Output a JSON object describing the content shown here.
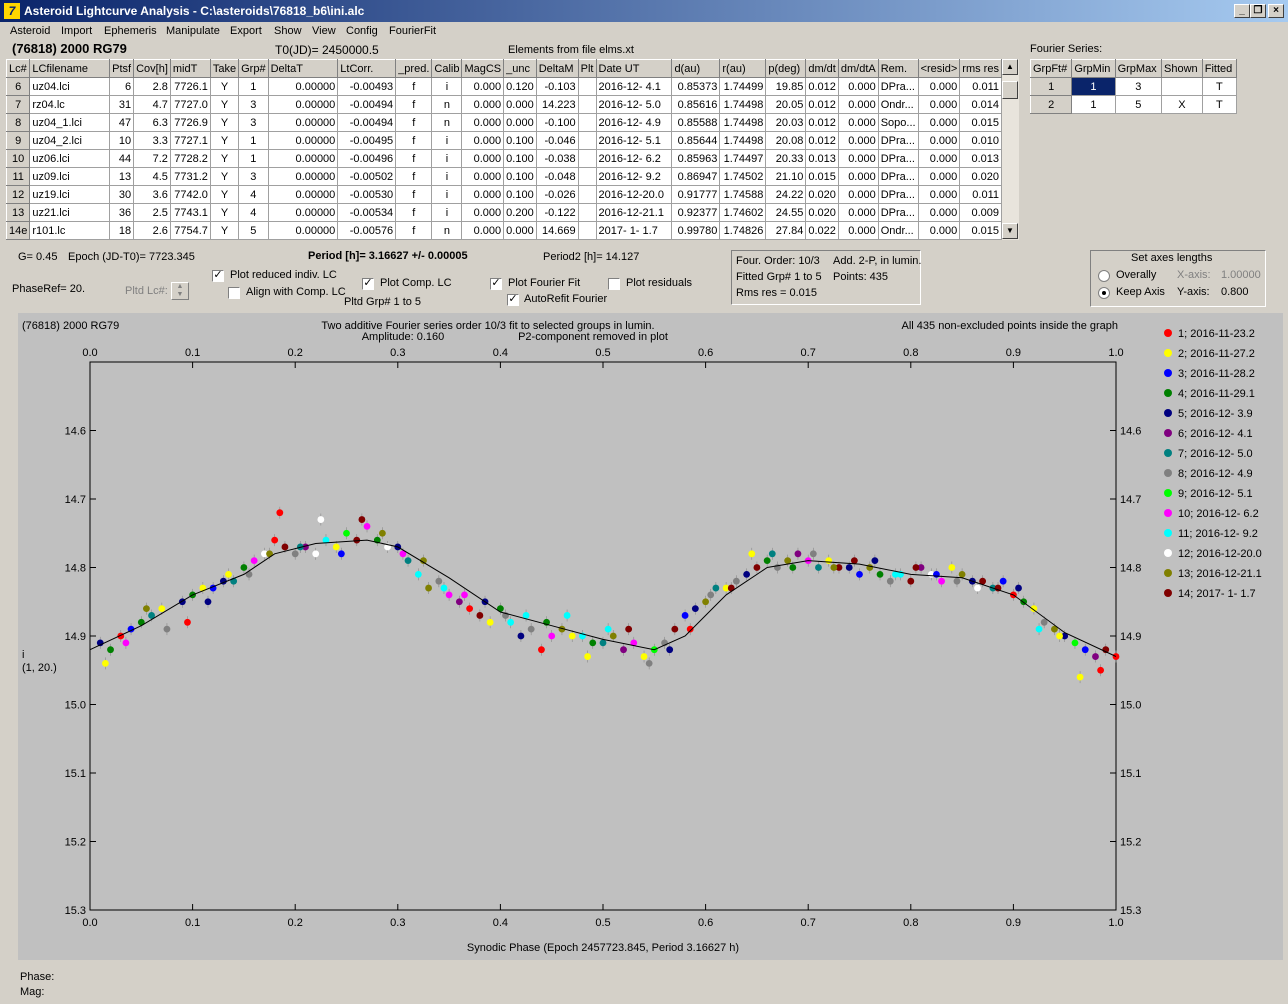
{
  "window": {
    "title": "Asteroid Lightcurve Analysis - C:\\asteroids\\76818_b6\\ini.alc",
    "icon": "7"
  },
  "menu": [
    "Asteroid",
    "Import",
    "Ephemeris",
    "Manipulate",
    "Export",
    "Show",
    "View",
    "Config",
    "FourierFit"
  ],
  "header": {
    "object": "(76818) 2000 RG79",
    "t0": "T0(JD)= 2450000.5",
    "elements": "Elements from file elms.xt"
  },
  "table": {
    "columns": [
      "Lc#",
      "LCfilename",
      "Ptsf",
      "Cov[h]",
      "midT",
      "Take",
      "Grp#",
      "DeltaT",
      "LtCorr.",
      "_pred.",
      "Calib",
      "MagCS",
      "_unc",
      "DeltaM",
      "Plt",
      "Date UT",
      "d(au)",
      "r(au)",
      "p(deg)",
      "dm/dt",
      "dm/dtA",
      "Rem.",
      "<resid>",
      "rms res"
    ],
    "rows": [
      [
        "6",
        "uz04.lci",
        "6",
        "2.8",
        "7726.1",
        "Y",
        "1",
        "0.00000",
        "-0.00493",
        "f",
        "i",
        "0.000",
        "0.120",
        "-0.103",
        "",
        "2016-12- 4.1",
        "0.85373",
        "1.74499",
        "19.85",
        "0.012",
        "0.000",
        "DPra...",
        "0.000",
        "0.011"
      ],
      [
        "7",
        "rz04.lc",
        "31",
        "4.7",
        "7727.0",
        "Y",
        "3",
        "0.00000",
        "-0.00494",
        "f",
        "n",
        "0.000",
        "0.000",
        "14.223",
        "",
        "2016-12- 5.0",
        "0.85616",
        "1.74498",
        "20.05",
        "0.012",
        "0.000",
        "Ondr...",
        "0.000",
        "0.014"
      ],
      [
        "8",
        "uz04_1.lci",
        "47",
        "6.3",
        "7726.9",
        "Y",
        "3",
        "0.00000",
        "-0.00494",
        "f",
        "n",
        "0.000",
        "0.000",
        "-0.100",
        "",
        "2016-12- 4.9",
        "0.85588",
        "1.74498",
        "20.03",
        "0.012",
        "0.000",
        "Sopo...",
        "0.000",
        "0.015"
      ],
      [
        "9",
        "uz04_2.lci",
        "10",
        "3.3",
        "7727.1",
        "Y",
        "1",
        "0.00000",
        "-0.00495",
        "f",
        "i",
        "0.000",
        "0.100",
        "-0.046",
        "",
        "2016-12- 5.1",
        "0.85644",
        "1.74498",
        "20.08",
        "0.012",
        "0.000",
        "DPra...",
        "0.000",
        "0.010"
      ],
      [
        "10",
        "uz06.lci",
        "44",
        "7.2",
        "7728.2",
        "Y",
        "1",
        "0.00000",
        "-0.00496",
        "f",
        "i",
        "0.000",
        "0.100",
        "-0.038",
        "",
        "2016-12- 6.2",
        "0.85963",
        "1.74497",
        "20.33",
        "0.013",
        "0.000",
        "DPra...",
        "0.000",
        "0.013"
      ],
      [
        "11",
        "uz09.lci",
        "13",
        "4.5",
        "7731.2",
        "Y",
        "3",
        "0.00000",
        "-0.00502",
        "f",
        "i",
        "0.000",
        "0.100",
        "-0.048",
        "",
        "2016-12- 9.2",
        "0.86947",
        "1.74502",
        "21.10",
        "0.015",
        "0.000",
        "DPra...",
        "0.000",
        "0.020"
      ],
      [
        "12",
        "uz19.lci",
        "30",
        "3.6",
        "7742.0",
        "Y",
        "4",
        "0.00000",
        "-0.00530",
        "f",
        "i",
        "0.000",
        "0.100",
        "-0.026",
        "",
        "2016-12-20.0",
        "0.91777",
        "1.74588",
        "24.22",
        "0.020",
        "0.000",
        "DPra...",
        "0.000",
        "0.011"
      ],
      [
        "13",
        "uz21.lci",
        "36",
        "2.5",
        "7743.1",
        "Y",
        "4",
        "0.00000",
        "-0.00534",
        "f",
        "i",
        "0.000",
        "0.200",
        "-0.122",
        "",
        "2016-12-21.1",
        "0.92377",
        "1.74602",
        "24.55",
        "0.020",
        "0.000",
        "DPra...",
        "0.000",
        "0.009"
      ],
      [
        "14e",
        "r101.lc",
        "18",
        "2.6",
        "7754.7",
        "Y",
        "5",
        "0.00000",
        "-0.00576",
        "f",
        "n",
        "0.000",
        "0.000",
        "14.669",
        "",
        "2017- 1- 1.7",
        "0.99780",
        "1.74826",
        "27.84",
        "0.022",
        "0.000",
        "Ondr...",
        "0.000",
        "0.015"
      ]
    ]
  },
  "fourier_series": {
    "title": "Fourier Series:",
    "columns": [
      "GrpFt#",
      "GrpMin",
      "GrpMax",
      "Shown",
      "Fitted"
    ],
    "rows": [
      [
        "1",
        "1",
        "3",
        "",
        "T"
      ],
      [
        "2",
        "1",
        "5",
        "X",
        "T"
      ]
    ]
  },
  "controls": {
    "g": "G= 0.45",
    "epoch": "Epoch (JD-T0)= 7723.345",
    "period": "Period [h]= 3.16627 +/- 0.00005",
    "period2": "Period2 [h]= 14.127",
    "phaseref": "PhaseRef= 20.",
    "pltd_lc": "Pltd Lc#:",
    "plot_reduced": "Plot reduced indiv. LC",
    "align_comp": "Align with Comp. LC",
    "plot_comp": "Plot Comp. LC",
    "pltd_grp": "Pltd Grp#  1   to   5",
    "plot_fourier": "Plot Fourier Fit",
    "autorefit": "AutoRefit Fourier",
    "plot_residuals": "Plot residuals",
    "info1": "Four. Order: 10/3",
    "info2": "Add. 2-P, in lumin.",
    "info3": "Fitted Grp# 1 to 5",
    "info4": "Points: 435",
    "info5": "Rms res      = 0.015",
    "axes_title": "Set axes lengths",
    "overally": "Overally",
    "keep_axis": "Keep Axis",
    "xaxis_label": "X-axis:",
    "xaxis_val": "1.00000",
    "yaxis_label": "Y-axis:",
    "yaxis_val": "0.800"
  },
  "plot": {
    "object": "(76818) 2000 RG79",
    "subtitle1": "Two additive Fourier series order 10/3 fit to selected groups in lumin.",
    "subtitle2": "Amplitude: 0.160",
    "subtitle3": "P2-component removed in plot",
    "note": "All 435 non-excluded points inside the graph",
    "xlabel": "Synodic Phase (Epoch 2457723.845, Period 3.16627 h)",
    "ylabel": "i",
    "ylabel2": "(1, 20.)"
  },
  "status": {
    "phase": "Phase:",
    "mag": "Mag:"
  },
  "chart_data": {
    "type": "scatter",
    "xlim": [
      0,
      1
    ],
    "ylim": [
      15.3,
      14.5
    ],
    "xticks": [
      "0.0",
      "0.1",
      "0.2",
      "0.3",
      "0.4",
      "0.5",
      "0.6",
      "0.7",
      "0.8",
      "0.9",
      "1.0"
    ],
    "yticks": [
      "14.6",
      "14.7",
      "14.8",
      "14.9",
      "15.0",
      "15.1",
      "15.2",
      "15.3"
    ],
    "legend_placement": "right",
    "legend": [
      {
        "name": "1; 2016-11-23.2",
        "color": "#ff0000"
      },
      {
        "name": "2; 2016-11-27.2",
        "color": "#ffff00"
      },
      {
        "name": "3; 2016-11-28.2",
        "color": "#0000ff"
      },
      {
        "name": "4; 2016-11-29.1",
        "color": "#008000"
      },
      {
        "name": "5; 2016-12- 3.9",
        "color": "#000080"
      },
      {
        "name": "6; 2016-12- 4.1",
        "color": "#800080"
      },
      {
        "name": "7; 2016-12- 5.0",
        "color": "#008080"
      },
      {
        "name": "8; 2016-12- 4.9",
        "color": "#808080"
      },
      {
        "name": "9; 2016-12- 5.1",
        "color": "#00ff00"
      },
      {
        "name": "10; 2016-12- 6.2",
        "color": "#ff00ff"
      },
      {
        "name": "11; 2016-12- 9.2",
        "color": "#00ffff"
      },
      {
        "name": "12; 2016-12-20.0",
        "color": "#ffffff"
      },
      {
        "name": "13; 2016-12-21.1",
        "color": "#808000"
      },
      {
        "name": "14; 2017- 1- 1.7",
        "color": "#800000"
      }
    ],
    "fit_curve": {
      "x": [
        0,
        0.05,
        0.1,
        0.15,
        0.18,
        0.22,
        0.27,
        0.3,
        0.35,
        0.4,
        0.45,
        0.5,
        0.55,
        0.58,
        0.62,
        0.66,
        0.7,
        0.75,
        0.8,
        0.85,
        0.9,
        0.95,
        1.0
      ],
      "y": [
        14.92,
        14.885,
        14.84,
        14.81,
        14.78,
        14.765,
        14.76,
        14.77,
        14.815,
        14.865,
        14.885,
        14.905,
        14.92,
        14.9,
        14.84,
        14.8,
        14.79,
        14.795,
        14.81,
        14.815,
        14.84,
        14.895,
        14.93
      ]
    },
    "points": [
      [
        0.01,
        14.91,
        4
      ],
      [
        0.02,
        14.92,
        3
      ],
      [
        0.03,
        14.9,
        0
      ],
      [
        0.04,
        14.89,
        2
      ],
      [
        0.05,
        14.88,
        3
      ],
      [
        0.06,
        14.87,
        6
      ],
      [
        0.07,
        14.86,
        1
      ],
      [
        0.09,
        14.85,
        4
      ],
      [
        0.1,
        14.84,
        3
      ],
      [
        0.11,
        14.83,
        1
      ],
      [
        0.12,
        14.83,
        2
      ],
      [
        0.13,
        14.82,
        4
      ],
      [
        0.14,
        14.82,
        6
      ],
      [
        0.15,
        14.8,
        3
      ],
      [
        0.16,
        14.79,
        9
      ],
      [
        0.17,
        14.78,
        11
      ],
      [
        0.18,
        14.76,
        0
      ],
      [
        0.19,
        14.77,
        13
      ],
      [
        0.2,
        14.78,
        7
      ],
      [
        0.21,
        14.77,
        5
      ],
      [
        0.22,
        14.78,
        11
      ],
      [
        0.23,
        14.76,
        10
      ],
      [
        0.24,
        14.77,
        1
      ],
      [
        0.25,
        14.75,
        8
      ],
      [
        0.26,
        14.76,
        13
      ],
      [
        0.27,
        14.74,
        9
      ],
      [
        0.28,
        14.76,
        3
      ],
      [
        0.29,
        14.77,
        11
      ],
      [
        0.3,
        14.77,
        4
      ],
      [
        0.31,
        14.79,
        6
      ],
      [
        0.32,
        14.81,
        10
      ],
      [
        0.33,
        14.83,
        12
      ],
      [
        0.34,
        14.82,
        7
      ],
      [
        0.35,
        14.84,
        9
      ],
      [
        0.36,
        14.85,
        5
      ],
      [
        0.37,
        14.86,
        0
      ],
      [
        0.38,
        14.87,
        13
      ],
      [
        0.39,
        14.88,
        1
      ],
      [
        0.4,
        14.86,
        3
      ],
      [
        0.41,
        14.88,
        10
      ],
      [
        0.42,
        14.9,
        4
      ],
      [
        0.43,
        14.89,
        7
      ],
      [
        0.44,
        14.92,
        0
      ],
      [
        0.45,
        14.9,
        9
      ],
      [
        0.46,
        14.89,
        12
      ],
      [
        0.47,
        14.9,
        1
      ],
      [
        0.48,
        14.9,
        10
      ],
      [
        0.49,
        14.91,
        3
      ],
      [
        0.5,
        14.91,
        6
      ],
      [
        0.51,
        14.9,
        12
      ],
      [
        0.52,
        14.92,
        5
      ],
      [
        0.53,
        14.91,
        9
      ],
      [
        0.54,
        14.93,
        1
      ],
      [
        0.55,
        14.92,
        8
      ],
      [
        0.56,
        14.91,
        7
      ],
      [
        0.57,
        14.89,
        13
      ],
      [
        0.58,
        14.87,
        2
      ],
      [
        0.59,
        14.86,
        4
      ],
      [
        0.6,
        14.85,
        12
      ],
      [
        0.61,
        14.83,
        6
      ],
      [
        0.62,
        14.83,
        1
      ],
      [
        0.63,
        14.82,
        7
      ],
      [
        0.64,
        14.81,
        4
      ],
      [
        0.65,
        14.8,
        13
      ],
      [
        0.66,
        14.79,
        3
      ],
      [
        0.67,
        14.8,
        7
      ],
      [
        0.68,
        14.79,
        12
      ],
      [
        0.69,
        14.78,
        5
      ],
      [
        0.7,
        14.79,
        9
      ],
      [
        0.71,
        14.8,
        6
      ],
      [
        0.72,
        14.79,
        1
      ],
      [
        0.73,
        14.8,
        13
      ],
      [
        0.74,
        14.8,
        4
      ],
      [
        0.75,
        14.81,
        2
      ],
      [
        0.76,
        14.8,
        12
      ],
      [
        0.77,
        14.81,
        3
      ],
      [
        0.78,
        14.82,
        7
      ],
      [
        0.79,
        14.81,
        10
      ],
      [
        0.8,
        14.82,
        13
      ],
      [
        0.81,
        14.8,
        5
      ],
      [
        0.82,
        14.81,
        11
      ],
      [
        0.83,
        14.82,
        9
      ],
      [
        0.84,
        14.8,
        1
      ],
      [
        0.85,
        14.81,
        12
      ],
      [
        0.86,
        14.82,
        4
      ],
      [
        0.87,
        14.82,
        13
      ],
      [
        0.88,
        14.83,
        6
      ],
      [
        0.89,
        14.82,
        2
      ],
      [
        0.9,
        14.84,
        0
      ],
      [
        0.91,
        14.85,
        3
      ],
      [
        0.92,
        14.86,
        1
      ],
      [
        0.93,
        14.88,
        7
      ],
      [
        0.94,
        14.89,
        12
      ],
      [
        0.95,
        14.9,
        4
      ],
      [
        0.96,
        14.91,
        8
      ],
      [
        0.97,
        14.92,
        2
      ],
      [
        0.98,
        14.93,
        5
      ],
      [
        0.99,
        14.92,
        13
      ],
      [
        1.0,
        14.93,
        0
      ],
      [
        0.015,
        14.94,
        1
      ],
      [
        0.035,
        14.91,
        9
      ],
      [
        0.055,
        14.86,
        12
      ],
      [
        0.075,
        14.89,
        7
      ],
      [
        0.095,
        14.88,
        0
      ],
      [
        0.115,
        14.85,
        4
      ],
      [
        0.135,
        14.81,
        1
      ],
      [
        0.155,
        14.81,
        7
      ],
      [
        0.175,
        14.78,
        12
      ],
      [
        0.185,
        14.72,
        0
      ],
      [
        0.205,
        14.77,
        6
      ],
      [
        0.225,
        14.73,
        11
      ],
      [
        0.245,
        14.78,
        2
      ],
      [
        0.265,
        14.73,
        13
      ],
      [
        0.285,
        14.75,
        12
      ],
      [
        0.305,
        14.78,
        9
      ],
      [
        0.325,
        14.79,
        12
      ],
      [
        0.345,
        14.83,
        10
      ],
      [
        0.365,
        14.84,
        9
      ],
      [
        0.385,
        14.85,
        4
      ],
      [
        0.405,
        14.87,
        7
      ],
      [
        0.425,
        14.87,
        10
      ],
      [
        0.445,
        14.88,
        3
      ],
      [
        0.465,
        14.87,
        10
      ],
      [
        0.485,
        14.93,
        1
      ],
      [
        0.505,
        14.89,
        10
      ],
      [
        0.525,
        14.89,
        13
      ],
      [
        0.545,
        14.94,
        7
      ],
      [
        0.565,
        14.92,
        4
      ],
      [
        0.585,
        14.89,
        0
      ],
      [
        0.605,
        14.84,
        7
      ],
      [
        0.625,
        14.83,
        13
      ],
      [
        0.645,
        14.78,
        1
      ],
      [
        0.665,
        14.78,
        6
      ],
      [
        0.685,
        14.8,
        3
      ],
      [
        0.705,
        14.78,
        7
      ],
      [
        0.725,
        14.8,
        12
      ],
      [
        0.745,
        14.79,
        13
      ],
      [
        0.765,
        14.79,
        4
      ],
      [
        0.785,
        14.81,
        10
      ],
      [
        0.805,
        14.8,
        13
      ],
      [
        0.825,
        14.81,
        2
      ],
      [
        0.845,
        14.82,
        7
      ],
      [
        0.865,
        14.83,
        11
      ],
      [
        0.885,
        14.83,
        13
      ],
      [
        0.905,
        14.83,
        4
      ],
      [
        0.925,
        14.89,
        10
      ],
      [
        0.945,
        14.9,
        1
      ],
      [
        0.965,
        14.96,
        1
      ],
      [
        0.985,
        14.95,
        0
      ]
    ]
  }
}
